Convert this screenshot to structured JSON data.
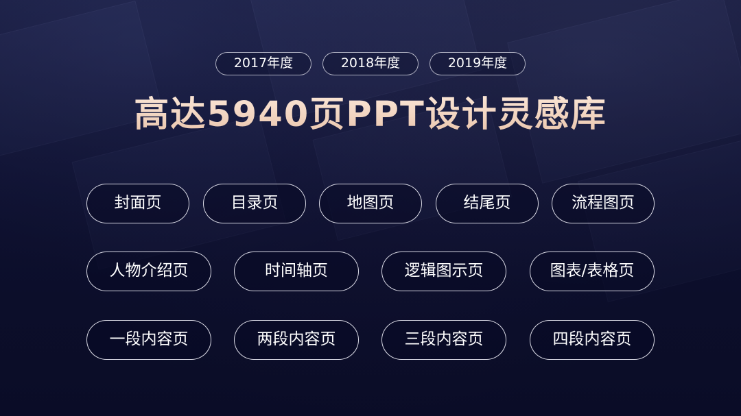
{
  "years": [
    "2017年度",
    "2018年度",
    "2019年度"
  ],
  "title": "高达5940页PPT设计灵感库",
  "rows": [
    [
      "封面页",
      "目录页",
      "地图页",
      "结尾页",
      "流程图页"
    ],
    [
      "人物介绍页",
      "时间轴页",
      "逻辑图示页",
      "图表/表格页"
    ],
    [
      "一段内容页",
      "两段内容页",
      "三段内容页",
      "四段内容页"
    ]
  ],
  "colors": {
    "background": "#12153a",
    "title": "#f4d9c6",
    "pill_border": "#f0f0f8",
    "text": "#ffffff"
  }
}
